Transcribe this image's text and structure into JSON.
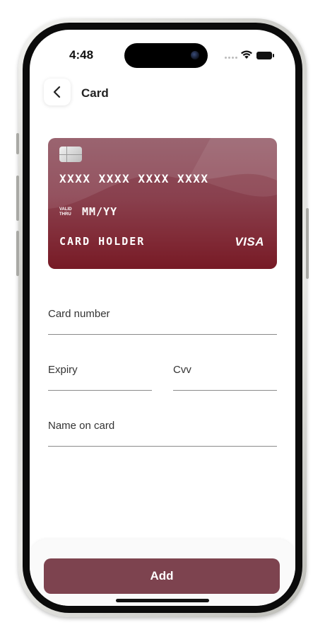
{
  "status_bar": {
    "time": "4:48",
    "wifi_icon": "wifi-icon",
    "battery_icon": "battery-icon"
  },
  "header": {
    "back_icon": "chevron-left-icon",
    "title": "Card"
  },
  "card": {
    "number": "XXXX XXXX XXXX XXXX",
    "valid_label_top": "VALID",
    "valid_label_bottom": "THRU",
    "expiry": "MM/YY",
    "holder": "CARD HOLDER",
    "brand": "VISA",
    "chip_icon": "card-chip-icon"
  },
  "form": {
    "card_number_label": "Card number",
    "expiry_label": "Expiry",
    "cvv_label": "Cvv",
    "name_label": "Name on card"
  },
  "actions": {
    "add_label": "Add"
  },
  "colors": {
    "accent": "#7d434f",
    "card_top": "#9a6470",
    "card_bottom": "#7a1c26"
  }
}
